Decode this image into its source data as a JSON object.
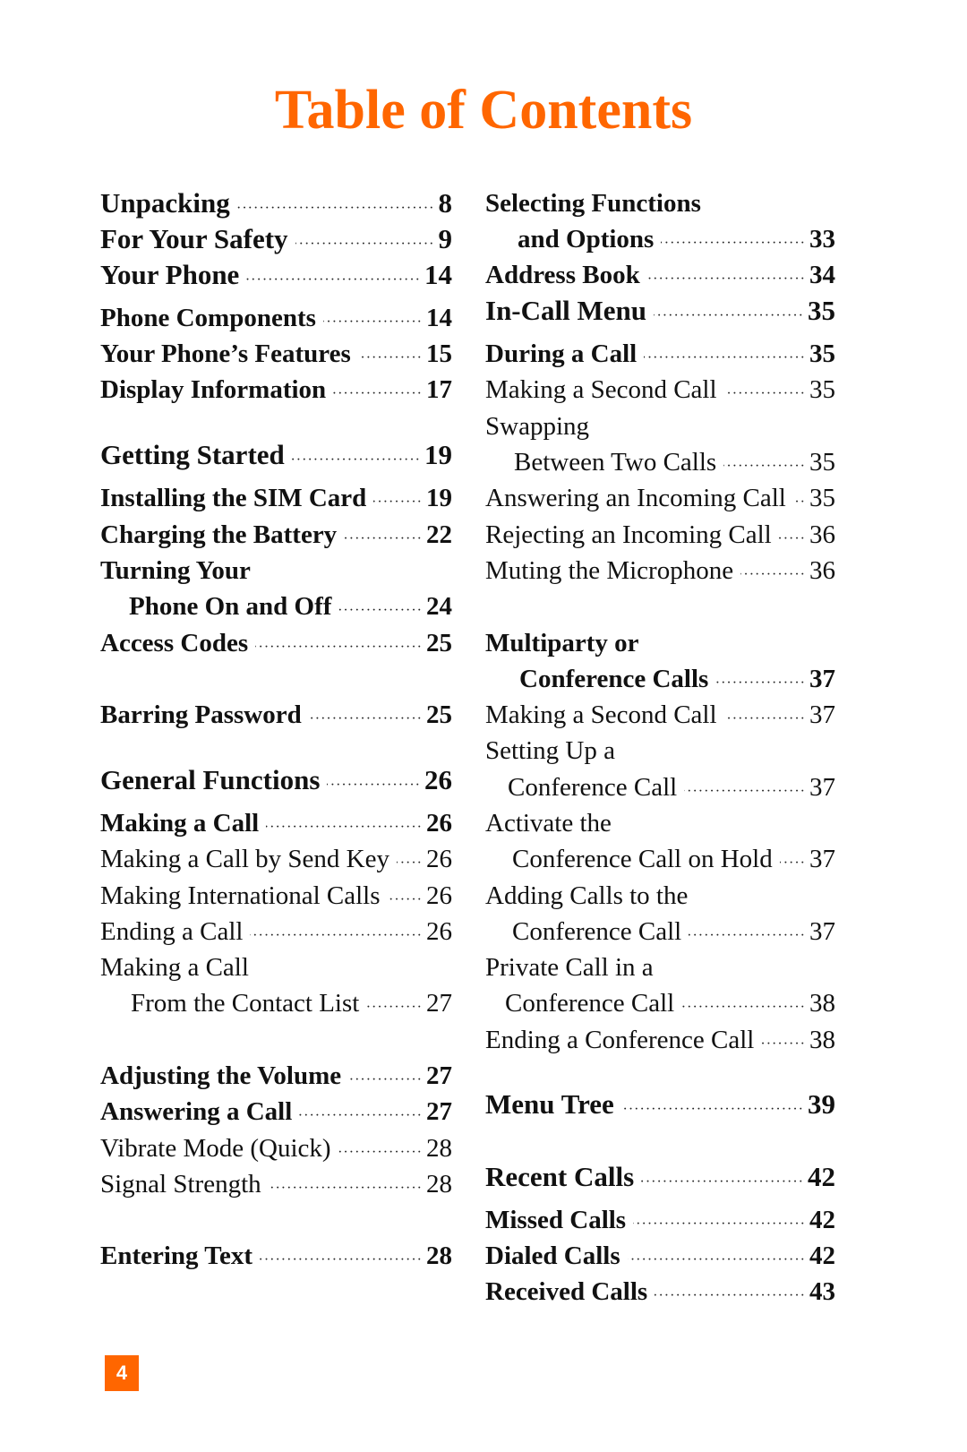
{
  "page": {
    "title": "Table of Contents",
    "page_number": "4",
    "accent_color": "#ff6600"
  },
  "left_column": [
    {
      "label": "Unpacking",
      "page": "8",
      "style": "bold-lg",
      "indent": 0
    },
    {
      "label": "For Your Safety",
      "page": "9",
      "style": "bold-lg",
      "indent": 0
    },
    {
      "label": "Your Phone",
      "page": "14",
      "style": "bold-lg",
      "indent": 0
    },
    {
      "label": "Phone Components",
      "page": "14",
      "style": "bold",
      "indent": 0
    },
    {
      "label": "Your Phone’s Features",
      "page": "15",
      "style": "bold",
      "indent": 0
    },
    {
      "label": "Display Information",
      "page": "17",
      "style": "bold",
      "indent": 0
    },
    {
      "label": "Getting Started",
      "page": "19",
      "style": "bold-lg",
      "indent": 0
    },
    {
      "label": "Installing the SIM Card",
      "page": "19",
      "style": "bold",
      "indent": 0
    },
    {
      "label": "Charging the Battery",
      "page": "22",
      "style": "bold",
      "indent": 0
    },
    {
      "label": "Turning Your",
      "page": "",
      "style": "bold",
      "indent": 0
    },
    {
      "label": "Phone On and Off",
      "page": "24",
      "style": "bold",
      "indent": 1
    },
    {
      "label": "Access Codes",
      "page": "25",
      "style": "bold",
      "indent": 0
    },
    {
      "label": "Barring Password",
      "page": "25",
      "style": "bold",
      "indent": 0
    },
    {
      "label": "General Functions",
      "page": "26",
      "style": "bold-lg",
      "indent": 0
    },
    {
      "label": "Making a Call",
      "page": "26",
      "style": "bold",
      "indent": 0
    },
    {
      "label": "Making a Call by Send Key",
      "page": "26",
      "style": "regular",
      "indent": 0
    },
    {
      "label": "Making International Calls",
      "page": "26",
      "style": "regular",
      "indent": 0
    },
    {
      "label": "Ending a Call",
      "page": "26",
      "style": "regular",
      "indent": 0
    },
    {
      "label": "Making a Call",
      "page": "",
      "style": "regular",
      "indent": 0
    },
    {
      "label": "From the Contact List",
      "page": "27",
      "style": "regular",
      "indent": 1
    },
    {
      "label": "Adjusting the Volume",
      "page": "27",
      "style": "bold",
      "indent": 0
    },
    {
      "label": "Answering a Call",
      "page": "27",
      "style": "bold",
      "indent": 0
    },
    {
      "label": "Vibrate Mode (Quick)",
      "page": "28",
      "style": "regular",
      "indent": 0
    },
    {
      "label": "Signal Strength",
      "page": "28",
      "style": "regular",
      "indent": 0
    },
    {
      "label": "Entering Text",
      "page": "28",
      "style": "bold",
      "indent": 0
    }
  ],
  "right_column": [
    {
      "label": "Selecting Functions",
      "page": "",
      "style": "bold",
      "indent": 0
    },
    {
      "label": "and Options",
      "page": "33",
      "style": "bold",
      "indent": 1
    },
    {
      "label": "Address Book",
      "page": "34",
      "style": "bold",
      "indent": 0
    },
    {
      "label": "In-Call Menu",
      "page": "35",
      "style": "bold-lg",
      "indent": 0
    },
    {
      "label": "During a Call",
      "page": "35",
      "style": "bold",
      "indent": 0
    },
    {
      "label": "Making a Second Call",
      "page": "35",
      "style": "regular",
      "indent": 0
    },
    {
      "label": "Swapping",
      "page": "",
      "style": "regular",
      "indent": 0
    },
    {
      "label": "Between Two Calls",
      "page": "35",
      "style": "regular",
      "indent": 1
    },
    {
      "label": "Answering an Incoming Call",
      "page": "35",
      "style": "regular",
      "indent": 0
    },
    {
      "label": "Rejecting an Incoming Call",
      "page": "36",
      "style": "regular",
      "indent": 0
    },
    {
      "label": "Muting the Microphone",
      "page": "36",
      "style": "regular",
      "indent": 0
    },
    {
      "label": "Multiparty or",
      "page": "",
      "style": "bold",
      "indent": 0
    },
    {
      "label": "Conference Calls",
      "page": "37",
      "style": "bold",
      "indent": 1
    },
    {
      "label": "Making a Second Call",
      "page": "37",
      "style": "regular",
      "indent": 0
    },
    {
      "label": "Setting Up a",
      "page": "",
      "style": "regular",
      "indent": 0
    },
    {
      "label": "Conference Call",
      "page": "37",
      "style": "regular",
      "indent": 1
    },
    {
      "label": "Activate the",
      "page": "",
      "style": "regular",
      "indent": 0
    },
    {
      "label": "Conference Call on Hold",
      "page": "37",
      "style": "regular",
      "indent": 1
    },
    {
      "label": "Adding Calls to the",
      "page": "",
      "style": "regular",
      "indent": 0
    },
    {
      "label": "Conference Call",
      "page": "37",
      "style": "regular",
      "indent": 1
    },
    {
      "label": "Private Call in a",
      "page": "",
      "style": "regular",
      "indent": 0
    },
    {
      "label": "Conference Call",
      "page": "38",
      "style": "regular",
      "indent": 1
    },
    {
      "label": "Ending a Conference Call",
      "page": "38",
      "style": "regular",
      "indent": 0
    },
    {
      "label": "Menu Tree",
      "page": "39",
      "style": "bold-lg",
      "indent": 0
    },
    {
      "label": "Recent Calls",
      "page": "42",
      "style": "bold-lg",
      "indent": 0
    },
    {
      "label": "Missed Calls",
      "page": "42",
      "style": "bold",
      "indent": 0
    },
    {
      "label": "Dialed Calls",
      "page": "42",
      "style": "bold",
      "indent": 0
    },
    {
      "label": "Received Calls",
      "page": "43",
      "style": "bold",
      "indent": 0
    }
  ]
}
